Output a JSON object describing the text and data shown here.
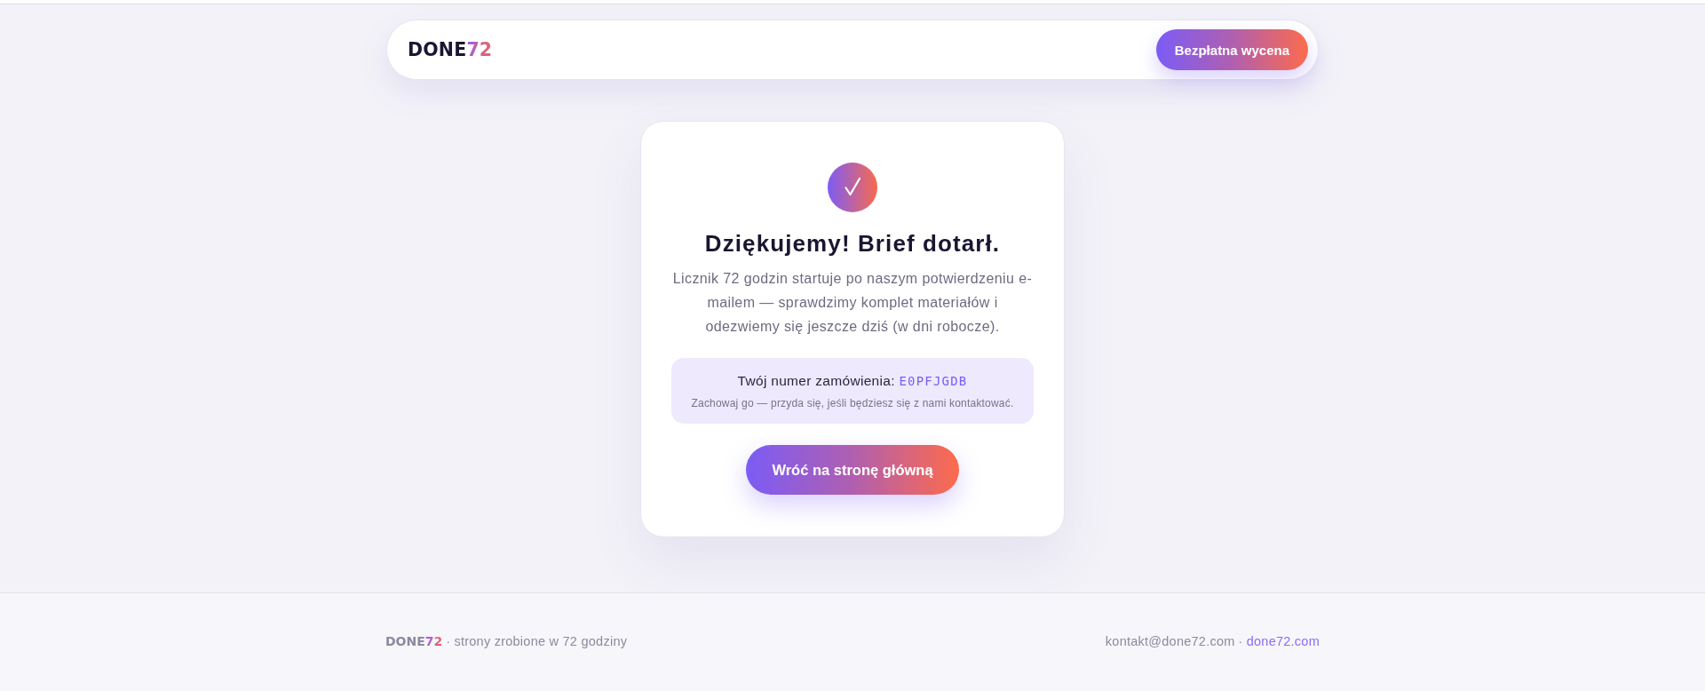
{
  "header": {
    "logo": {
      "name": "DONE",
      "accent": "72"
    },
    "cta_button": "Bezpłatna wycena"
  },
  "confirmation": {
    "title": "Dziękujemy! Brief dotarł.",
    "message": "Licznik 72 godzin startuje po naszym potwierdzeniu e-mailem — sprawdzimy komplet materiałów i odezwiemy się jeszcze dziś (w dni robocze).",
    "order": {
      "label": "Twój numer zamówienia:",
      "number": "E0PFJGDB",
      "note": "Zachowaj go — przyda się, jeśli będziesz się z nami kontaktować."
    },
    "button": "Wróć na stronę główną"
  },
  "footer": {
    "logo": {
      "name": "DONE",
      "accent": "72"
    },
    "tagline_separator": "·",
    "tagline": "strony zrobione w 72 godziny",
    "email": "kontakt@done72.com",
    "links_separator": "·",
    "website": "done72.com"
  }
}
